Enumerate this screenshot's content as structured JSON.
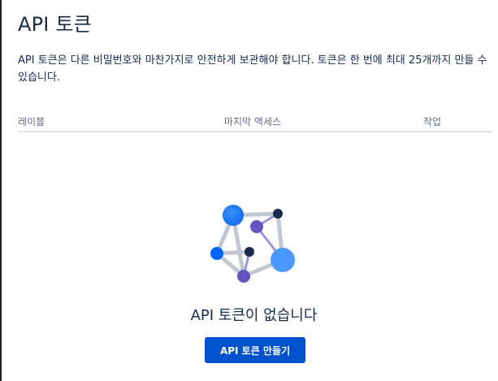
{
  "page": {
    "title": "API 토큰",
    "description": "API 토큰은 다른 비밀번호와 마찬가지로 안전하게 보관해야 합니다. 토큰은 한 번에 최대 25개까지 만들 수 있습니다."
  },
  "table": {
    "headers": [
      "레이블",
      "마지막 액세스",
      "작업"
    ]
  },
  "empty_state": {
    "title": "API 토큰이 없습니다",
    "illustration_icon": "network-nodes-icon",
    "button_label": "API 토큰 만들기"
  },
  "colors": {
    "primary": "#0052cc",
    "text": "#172b4d",
    "subtle_text": "#5e6c84",
    "divider": "#dfe1e6"
  }
}
